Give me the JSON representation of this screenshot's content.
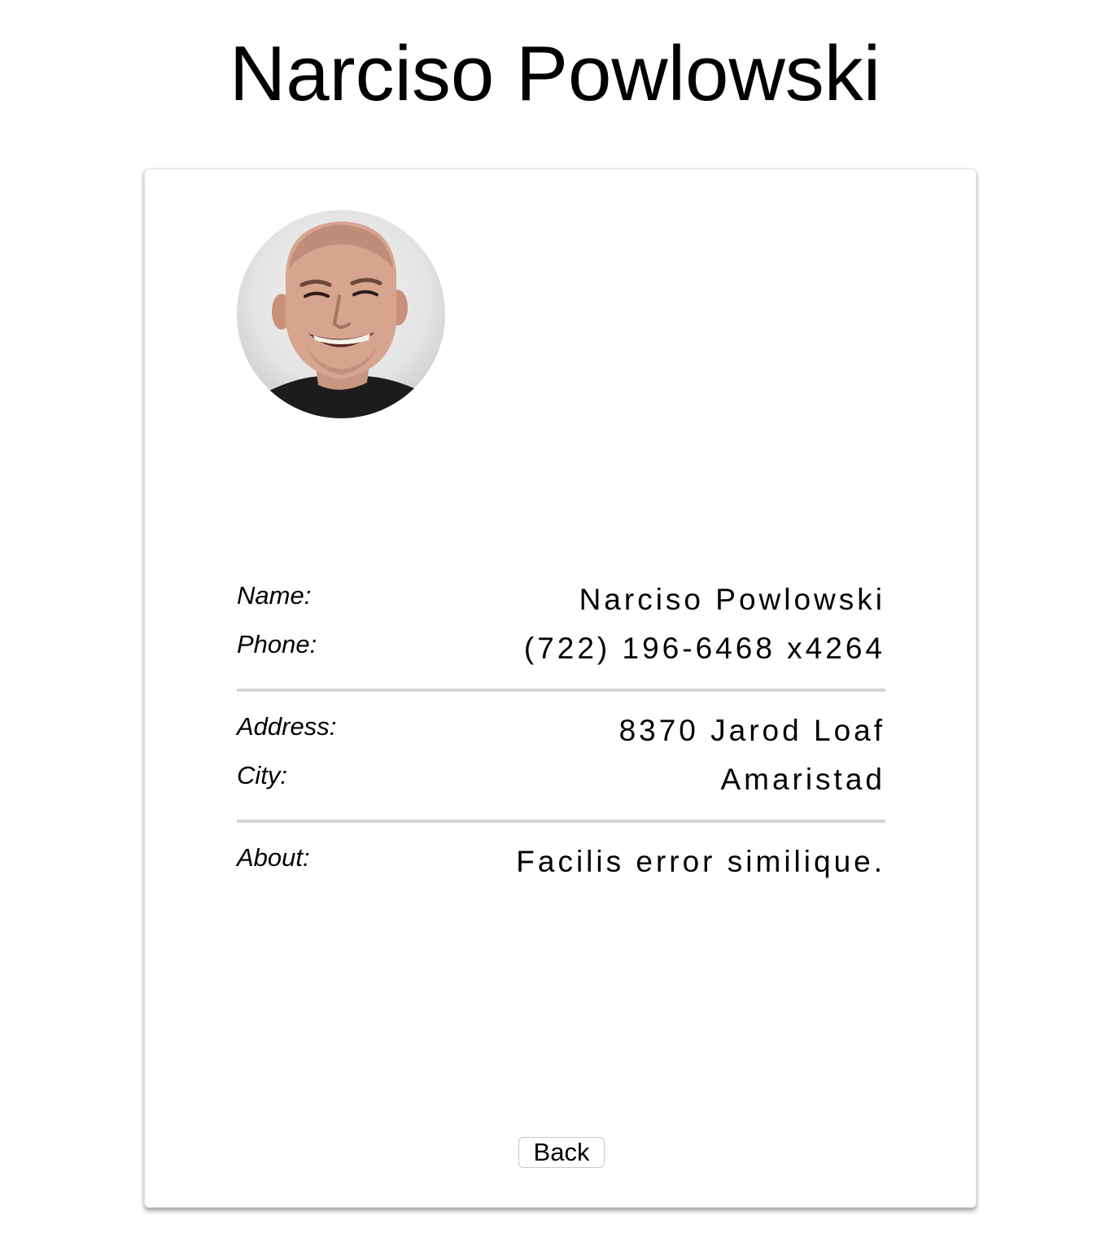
{
  "page": {
    "title": "Narciso Powlowski"
  },
  "profile": {
    "rows_group1": [
      {
        "label": "Name:",
        "value": "Narciso Powlowski"
      },
      {
        "label": "Phone:",
        "value": "(722) 196-6468 x4264"
      }
    ],
    "rows_group2": [
      {
        "label": "Address:",
        "value": "8370 Jarod Loaf"
      },
      {
        "label": "City:",
        "value": "Amaristad"
      }
    ],
    "rows_group3": [
      {
        "label": "About:",
        "value": "Facilis error similique."
      }
    ]
  },
  "actions": {
    "back_label": "Back"
  }
}
